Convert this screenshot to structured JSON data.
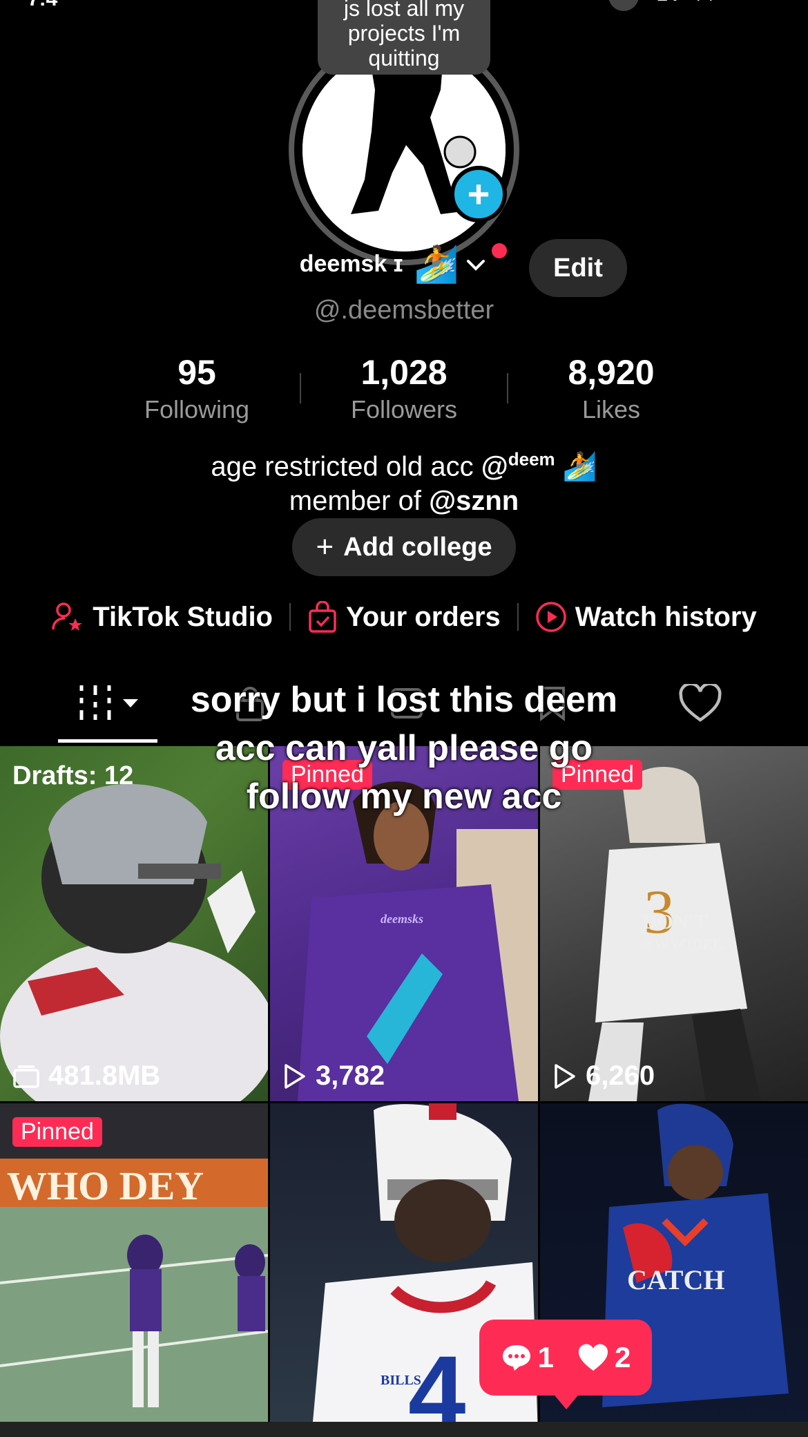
{
  "status": {
    "time": "7:4",
    "count": "14"
  },
  "note": {
    "text": "js lost all my projects I'm quitting"
  },
  "profile": {
    "username": "deemsk ɪ",
    "surfer_emoji": "🏄",
    "handle": "@.deemsbetter",
    "edit_label": "Edit"
  },
  "stats": [
    {
      "value": "95",
      "label": "Following"
    },
    {
      "value": "1,028",
      "label": "Followers"
    },
    {
      "value": "8,920",
      "label": "Likes"
    }
  ],
  "bio": {
    "line1_text": "age restricted old acc ",
    "line1_mention": "@",
    "line1_sup": "deem",
    "line1_emoji": " 🏄",
    "line2_text": "member of ",
    "line2_mention": "@sznn"
  },
  "add_college": {
    "plus": "+",
    "label": "Add college"
  },
  "quick_links": [
    {
      "label": "TikTok Studio",
      "icon": "person-star-icon"
    },
    {
      "label": "Your orders",
      "icon": "shopping-bag-icon"
    },
    {
      "label": "Watch history",
      "icon": "play-circle-icon"
    }
  ],
  "caption": {
    "line1": "sorry but i lost this deem",
    "line2": "acc can yall please go",
    "line3": "follow my new acc"
  },
  "grid": [
    {
      "type": "drafts",
      "drafts_label": "Drafts: 12",
      "size": "481.8MB"
    },
    {
      "type": "pinned",
      "badge": "Pinned",
      "views": "3,782",
      "overlay": "deemsks"
    },
    {
      "type": "pinned",
      "badge": "Pinned",
      "views": "6,260",
      "overlay1": "DON'T",
      "overlay2": "@WYODEE"
    },
    {
      "type": "pinned",
      "badge": "Pinned",
      "overlay": "WHO DEY"
    },
    {
      "type": "video",
      "overlay": "BILLS"
    },
    {
      "type": "video",
      "overlay": "CATCH"
    }
  ],
  "activity": {
    "comments": "1",
    "likes": "2"
  },
  "colors": {
    "accent": "#fe2c55",
    "plus_blue": "#1fb6e6",
    "pill_bg": "#2b2b2b"
  }
}
